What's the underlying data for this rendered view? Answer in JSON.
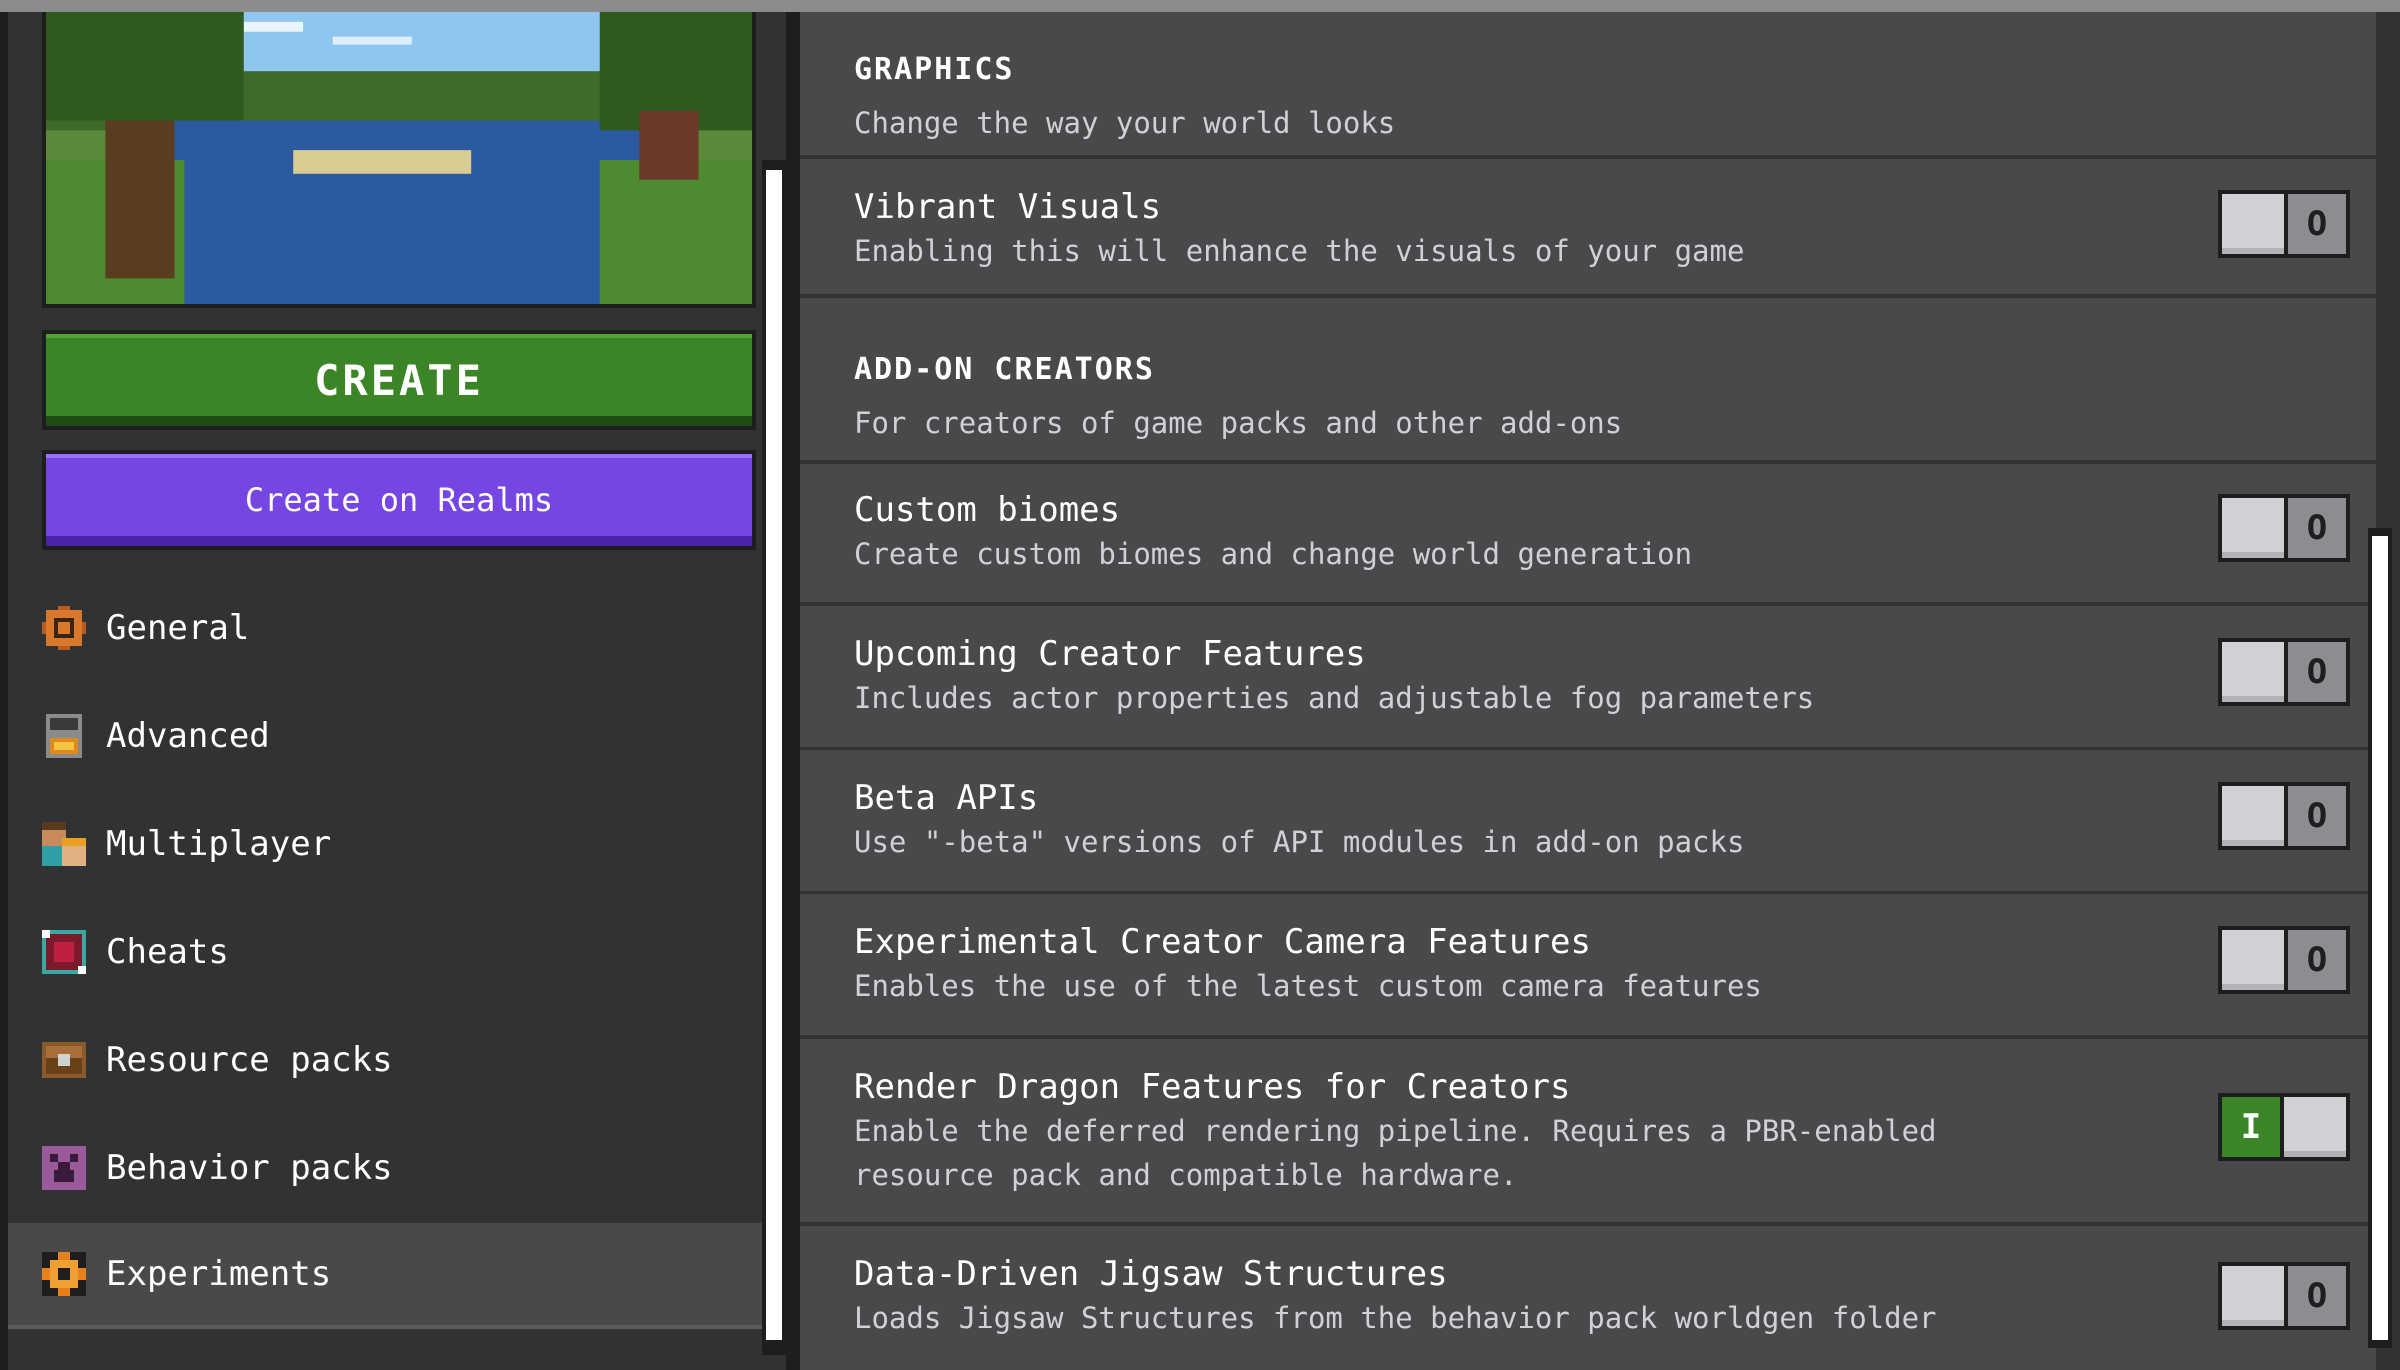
{
  "create_button": "CREATE",
  "realms_button": "Create on Realms",
  "nav": [
    {
      "label": "General",
      "icon": "gear-icon"
    },
    {
      "label": "Advanced",
      "icon": "advanced-icon"
    },
    {
      "label": "Multiplayer",
      "icon": "players-icon"
    },
    {
      "label": "Cheats",
      "icon": "cheats-icon"
    },
    {
      "label": "Resource packs",
      "icon": "chest-icon"
    },
    {
      "label": "Behavior packs",
      "icon": "creeper-icon"
    },
    {
      "label": "Experiments",
      "icon": "experiments-icon",
      "active": true
    }
  ],
  "sections": {
    "graphics": {
      "title": "GRAPHICS",
      "subtitle": "Change the way your world looks"
    },
    "addon": {
      "title": "ADD-ON CREATORS",
      "subtitle": "For creators of game packs and other add-ons"
    }
  },
  "settings": [
    {
      "title": "Vibrant Visuals",
      "desc": "Enabling this will enhance the visuals of your game",
      "enabled": false
    },
    {
      "title": "Custom biomes",
      "desc": "Create custom biomes and change world generation",
      "enabled": false
    },
    {
      "title": "Upcoming Creator Features",
      "desc": "Includes actor properties and adjustable fog parameters",
      "enabled": false
    },
    {
      "title": "Beta APIs",
      "desc": "Use \"-beta\" versions of API modules in add-on packs",
      "enabled": false
    },
    {
      "title": "Experimental Creator Camera Features",
      "desc": "Enables the use of the latest custom camera features",
      "enabled": false
    },
    {
      "title": "Render Dragon Features for Creators",
      "desc": "Enable the deferred rendering pipeline. Requires a PBR-enabled",
      "desc2": "resource pack and compatible hardware.",
      "enabled": true
    },
    {
      "title": "Data-Driven Jigsaw Structures",
      "desc": "Loads Jigsaw Structures from the behavior pack worldgen folder",
      "enabled": false
    }
  ],
  "toggle_marks": {
    "off": "O",
    "on": "I"
  },
  "colors": {
    "create_green": "#3c8527",
    "realms_purple": "#7646e3",
    "panel": "#48494a",
    "background": "#313233"
  }
}
